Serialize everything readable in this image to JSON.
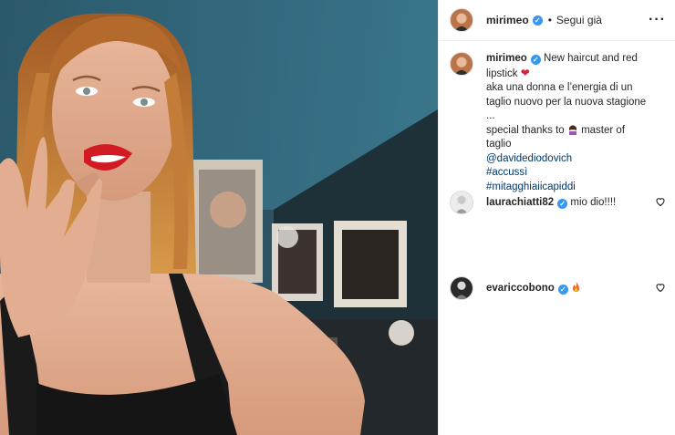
{
  "post": {
    "author": "mirimeo",
    "follow_label": "Segui già",
    "dot": "•",
    "more_icon": "ellipsis-icon",
    "verified_mark": "✓"
  },
  "caption": {
    "author": "mirimeo",
    "line1": "New haircut and red lipstick",
    "heart": "❤",
    "line2": "aka una donna e l’energia di un taglio nuovo per la nuova stagione ...",
    "line3_pre": "special thanks to",
    "line3_post": "master of taglio",
    "mention": "@davidediodovich",
    "hashtags": [
      "#accussì",
      "#mitagghiaiicapiddi"
    ]
  },
  "comments": [
    {
      "user": "laurachiatti82",
      "text": "mio dio!!!!"
    },
    {
      "user": "evariccobono",
      "text": ""
    }
  ],
  "colors": {
    "verified": "#3897f0",
    "link": "#00376b",
    "photo_bg": "#2f4a56"
  }
}
